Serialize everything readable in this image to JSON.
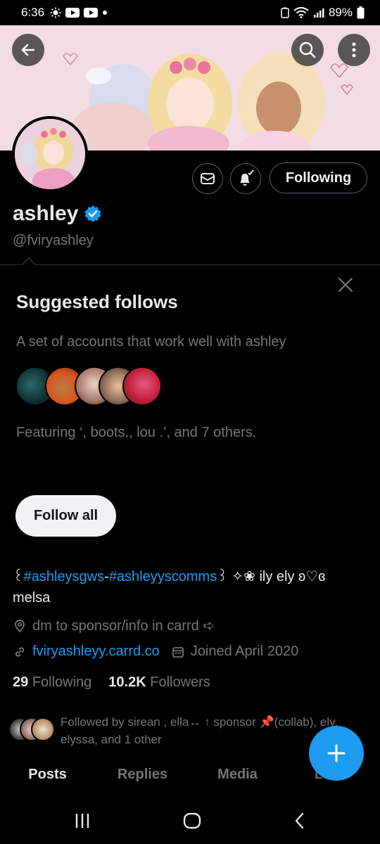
{
  "status_bar": {
    "time": "6:36",
    "battery": "89%"
  },
  "profile": {
    "name": "ashley",
    "handle": "@fviryashley",
    "following_button": "Following",
    "verified": true
  },
  "suggested": {
    "title": "Suggested follows",
    "description": "A set of accounts that work well with ashley",
    "featuring": "Featuring ‘, boots., lou .’, and 7 others.",
    "follow_all": "Follow all"
  },
  "bio": {
    "prefix": "꒰",
    "tag1": "#ashleysgws",
    "sep": "-",
    "tag2": "#ashleyyscomms",
    "suffix": "꒱ ✧❀ ily ely ʚ♡ɞ",
    "line2": "melsa"
  },
  "meta": {
    "location": "dm to sponsor/info in carrd ➪",
    "url": "fviryashleyy.carrd.co",
    "joined": "Joined April 2020"
  },
  "stats": {
    "following_count": "29",
    "following_label": "Following",
    "followers_count": "10.2K",
    "followers_label": "Followers"
  },
  "followed_by": {
    "text": "Followed by sirean , ella↔ ↑ sponsor 📌(collab), ely, elyssa, and 1 other"
  },
  "tabs": [
    "Posts",
    "Replies",
    "Media",
    "Likes"
  ],
  "colors": {
    "accent": "#1d9bf0",
    "secondary_text": "#71767b"
  }
}
